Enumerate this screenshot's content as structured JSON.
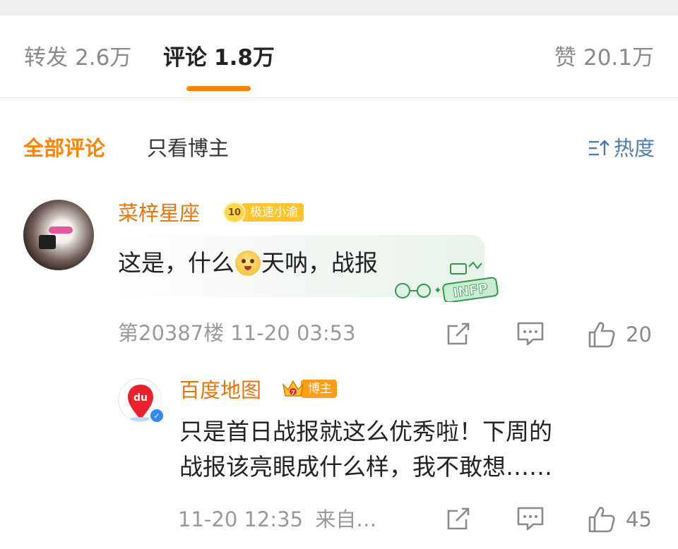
{
  "tabs": {
    "repost_label": "转发",
    "repost_count": "2.6万",
    "comment_label": "评论",
    "comment_count": "1.8万",
    "like_label": "赞",
    "like_count": "20.1万",
    "active": "comment"
  },
  "filters": {
    "all": "全部评论",
    "blogger_only": "只看博主",
    "sort": "热度"
  },
  "comments": [
    {
      "user": "菜梓星座",
      "level": "10",
      "badge": "极速小渝",
      "text_parts": [
        "这是，什么",
        "天呐，战报"
      ],
      "emoji": "cry-smile-emoji",
      "sticker": "INFP",
      "floor": "第20387楼",
      "time": "11-20 03:53",
      "like_count": "20",
      "reply": {
        "user": "百度地图",
        "avatar_text": "du",
        "badge": "博主",
        "crown_level": "7",
        "lines": [
          "只是首日战报就这么优秀啦！下周的",
          "战报该亮眼成什么样，我不敢想……"
        ],
        "time": "11-20 12:35",
        "source": "来自…",
        "like_count": "45"
      }
    }
  ],
  "colors": {
    "accent": "#ff8200",
    "username": "#e8740c",
    "link_blue": "#4a7bb8",
    "muted": "#9a9a9a"
  }
}
